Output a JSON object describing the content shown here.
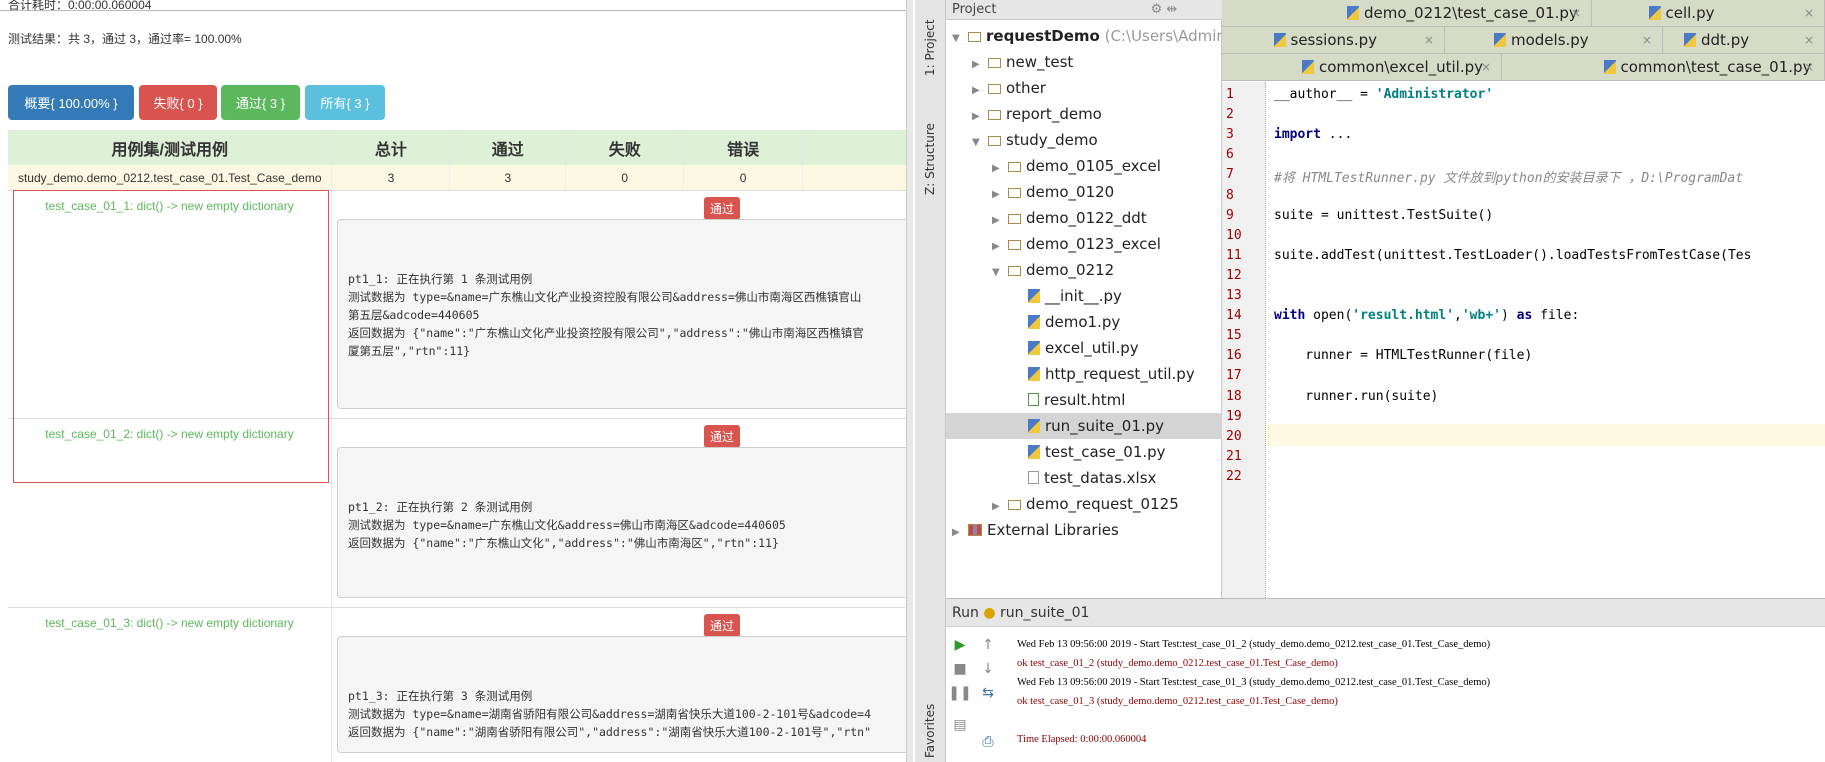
{
  "report": {
    "elapsed": "合计耗时：0:00:00.060004",
    "result": "测试结果：共 3，通过 3，通过率= 100.00%",
    "buttons": [
      {
        "label": "概要{ 100.00% }",
        "color": "#337ab7"
      },
      {
        "label": "失败{ 0 }",
        "color": "#d9534f"
      },
      {
        "label": "通过{ 3 }",
        "color": "#5cb85c"
      },
      {
        "label": "所有{ 3 }",
        "color": "#5bc0de"
      }
    ],
    "headers": [
      "用例集/测试用例",
      "总计",
      "通过",
      "失败",
      "错误",
      ""
    ],
    "summary_row": [
      "study_demo.demo_0212.test_case_01.Test_Case_demo",
      "3",
      "3",
      "0",
      "0",
      ""
    ],
    "cases": [
      {
        "name": "test_case_01_1: dict() -> new empty dictionary",
        "status": "通过",
        "output": "pt1_1: 正在执行第 1 条测试用例\n测试数据为 type=&name=广东樵山文化产业投资控股有限公司&address=佛山市南海区西樵镇官山\n第五层&adcode=440605\n返回数据为 {\"name\":\"广东樵山文化产业投资控股有限公司\",\"address\":\"佛山市南海区西樵镇官\n厦第五层\",\"rtn\":11}"
      },
      {
        "name": "test_case_01_2: dict() -> new empty dictionary",
        "status": "通过",
        "output": "pt1_2: 正在执行第 2 条测试用例\n测试数据为 type=&name=广东樵山文化&address=佛山市南海区&adcode=440605\n返回数据为 {\"name\":\"广东樵山文化\",\"address\":\"佛山市南海区\",\"rtn\":11}"
      },
      {
        "name": "test_case_01_3: dict() -> new empty dictionary",
        "status": "通过",
        "output": "pt1_3: 正在执行第 3 条测试用例\n测试数据为 type=&name=湖南省骄阳有限公司&address=湖南省快乐大道100-2-101号&adcode=4\n返回数据为 {\"name\":\"湖南省骄阳有限公司\",\"address\":\"湖南省快乐大道100-2-101号\",\"rtn\""
      }
    ]
  },
  "ide": {
    "side_tabs": [
      "1: Project",
      "Z: Structure",
      "Favorites"
    ],
    "project_header": "Project",
    "tree": [
      {
        "label": "requestDemo",
        "extra": " (C:\\Users\\Admin",
        "depth": 0,
        "arrow": "▼",
        "icon": "folder"
      },
      {
        "label": "new_test",
        "depth": 1,
        "arrow": "▶",
        "icon": "folder"
      },
      {
        "label": "other",
        "depth": 1,
        "arrow": "▶",
        "icon": "folder"
      },
      {
        "label": "report_demo",
        "depth": 1,
        "arrow": "▶",
        "icon": "folder"
      },
      {
        "label": "study_demo",
        "depth": 1,
        "arrow": "▼",
        "icon": "folder"
      },
      {
        "label": "demo_0105_excel",
        "depth": 2,
        "arrow": "▶",
        "icon": "folder"
      },
      {
        "label": "demo_0120",
        "depth": 2,
        "arrow": "▶",
        "icon": "folder"
      },
      {
        "label": "demo_0122_ddt",
        "depth": 2,
        "arrow": "▶",
        "icon": "folder"
      },
      {
        "label": "demo_0123_excel",
        "depth": 2,
        "arrow": "▶",
        "icon": "folder"
      },
      {
        "label": "demo_0212",
        "depth": 2,
        "arrow": "▼",
        "icon": "folder"
      },
      {
        "label": "__init__.py",
        "depth": 3,
        "arrow": "",
        "icon": "py"
      },
      {
        "label": "demo1.py",
        "depth": 3,
        "arrow": "",
        "icon": "py"
      },
      {
        "label": "excel_util.py",
        "depth": 3,
        "arrow": "",
        "icon": "py"
      },
      {
        "label": "http_request_util.py",
        "depth": 3,
        "arrow": "",
        "icon": "py"
      },
      {
        "label": "result.html",
        "depth": 3,
        "arrow": "",
        "icon": "html"
      },
      {
        "label": "run_suite_01.py",
        "depth": 3,
        "arrow": "",
        "icon": "py",
        "selected": true
      },
      {
        "label": "test_case_01.py",
        "depth": 3,
        "arrow": "",
        "icon": "py"
      },
      {
        "label": "test_datas.xlsx",
        "depth": 3,
        "arrow": "",
        "icon": "file"
      },
      {
        "label": "demo_request_0125",
        "depth": 2,
        "arrow": "▶",
        "icon": "folder"
      },
      {
        "label": "External Libraries",
        "depth": 0,
        "arrow": "▶",
        "icon": "library"
      }
    ],
    "tab_rows": [
      [
        "demo_0212\\test_case_01.py",
        "cell.py"
      ],
      [
        "sessions.py",
        "models.py",
        "ddt.py"
      ],
      [
        "common\\excel_util.py",
        "common\\test_case_01.py"
      ]
    ],
    "code": [
      {
        "n": "1",
        "text": "__author__ = 'Administrator'"
      },
      {
        "n": "2",
        "text": ""
      },
      {
        "n": "3",
        "text": "import ..."
      },
      {
        "n": "6",
        "text": ""
      },
      {
        "n": "7",
        "text": "#将 HTMLTestRunner.py 文件放到python的安装目录下 ，D:\\ProgramDat"
      },
      {
        "n": "8",
        "text": ""
      },
      {
        "n": "9",
        "text": "suite = unittest.TestSuite()"
      },
      {
        "n": "10",
        "text": ""
      },
      {
        "n": "11",
        "text": "suite.addTest(unittest.TestLoader().loadTestsFromTestCase(Tes"
      },
      {
        "n": "12",
        "text": ""
      },
      {
        "n": "13",
        "text": ""
      },
      {
        "n": "14",
        "text": "with open('result.html','wb+') as file:"
      },
      {
        "n": "15",
        "text": ""
      },
      {
        "n": "16",
        "text": "    runner = HTMLTestRunner(file)"
      },
      {
        "n": "17",
        "text": ""
      },
      {
        "n": "18",
        "text": "    runner.run(suite)"
      },
      {
        "n": "19",
        "text": ""
      },
      {
        "n": "20",
        "text": ""
      },
      {
        "n": "21",
        "text": ""
      },
      {
        "n": "22",
        "text": ""
      }
    ],
    "run": {
      "label": "Run",
      "config": "run_suite_01",
      "lines": [
        {
          "text": "Wed Feb 13 09:56:00 2019 - Start Test:test_case_01_2 (study_demo.demo_0212.test_case_01.Test_Case_demo)",
          "color": "#000000"
        },
        {
          "text": "ok test_case_01_2 (study_demo.demo_0212.test_case_01.Test_Case_demo)",
          "color": "#8b0000"
        },
        {
          "text": "Wed Feb 13 09:56:00 2019 - Start Test:test_case_01_3 (study_demo.demo_0212.test_case_01.Test_Case_demo)",
          "color": "#000000"
        },
        {
          "text": "ok test_case_01_3 (study_demo.demo_0212.test_case_01.Test_Case_demo)",
          "color": "#8b0000"
        },
        {
          "text": "",
          "color": "#000000"
        },
        {
          "text": "Time Elapsed: 0:00:00.060004",
          "color": "#8b0000"
        }
      ]
    }
  }
}
